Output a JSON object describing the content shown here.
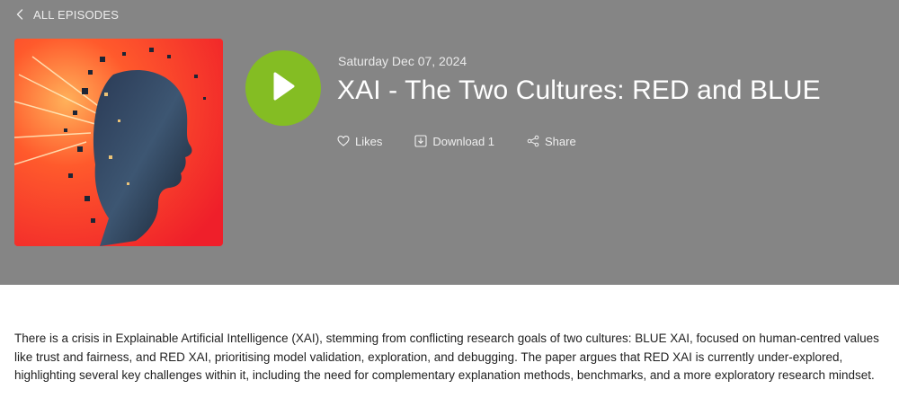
{
  "nav": {
    "back_label": "ALL EPISODES"
  },
  "episode": {
    "date": "Saturday Dec 07, 2024",
    "title": "XAI - The Two Cultures: RED and BLUE",
    "cover_alt": "Fragmenting digital head artwork",
    "description": "There is a crisis in Explainable Artificial Intelligence (XAI), stemming from conflicting research goals of two cultures: BLUE XAI, focused on human-centred values like trust and fairness, and RED XAI, prioritising model validation, exploration, and debugging. The paper argues that RED XAI is currently under-explored, highlighting several key challenges within it, including the need for complementary explanation methods, benchmarks, and a more exploratory research mindset."
  },
  "actions": {
    "likes_label": "Likes",
    "download_label": "Download 1",
    "share_label": "Share"
  },
  "icons": {
    "back": "chevron-left-icon",
    "play": "play-icon",
    "likes": "heart-icon",
    "download": "download-icon",
    "share": "share-icon"
  },
  "colors": {
    "header_bg": "#858585",
    "play_button": "#84bd23",
    "cover_bg": "#ff3b2a"
  }
}
